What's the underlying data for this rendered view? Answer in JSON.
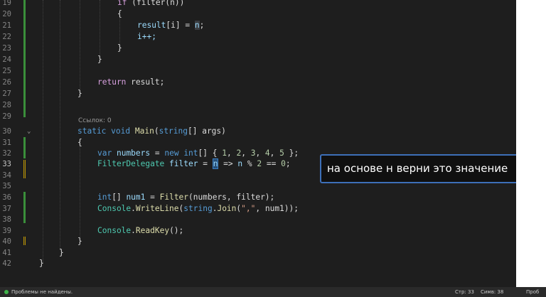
{
  "line_numbers": [
    "19",
    "20",
    "21",
    "22",
    "23",
    "24",
    "25",
    "26",
    "27",
    "28",
    "29",
    "30",
    "31",
    "32",
    "33",
    "34",
    "35",
    "36",
    "37",
    "38",
    "39",
    "40",
    "41",
    "42"
  ],
  "codelens": "Ссылок: 0",
  "code": {
    "l19_if": "if",
    "l19_rest": " (filter(n))",
    "l20": "{",
    "l21_result": "result",
    "l21_idx": "[i]",
    "l21_eq": " = ",
    "l21_n": "n",
    "l21_semi": ";",
    "l22": "i++;",
    "l23": "}",
    "l24": "}",
    "l26_return": "return",
    "l26_rest": " result;",
    "l27": "}",
    "l30_static": "static",
    "l30_void": "void",
    "l30_main": "Main",
    "l30_paren": "(",
    "l30_string": "string",
    "l30_args": "[] args)",
    "l31": "{",
    "l32_var": "var",
    "l32_numbers": "numbers",
    "l32_eq": " = ",
    "l32_new": "new",
    "l32_int": "int",
    "l32_arr": "[] { ",
    "l32_n1": "1",
    "l32_n2": "2",
    "l32_n3": "3",
    "l32_n4": "4",
    "l32_n5": "5",
    "l32_end": " };",
    "comma": ", ",
    "l33_type": "FilterDelegate",
    "l33_filter": "filter",
    "l33_eq": " = ",
    "l33_n": "n",
    "l33_arrow": " => ",
    "l33_n2": "n",
    "l33_mod": " % ",
    "l33_two": "2",
    "l33_eqeq": " == ",
    "l33_zero": "0",
    "l33_semi": ";",
    "l36_int": "int",
    "l36_arr": "[] ",
    "l36_num1": "num1",
    "l36_eq": " = ",
    "l36_filter": "Filter",
    "l36_args": "(numbers, filter);",
    "l37_console": "Console",
    "l37_dot": ".",
    "l37_write": "WriteLine",
    "l37_p": "(",
    "l37_string": "string",
    "l37_join": "Join",
    "l37_str": "\",\"",
    "l37_rest": ", num1));",
    "l39_console": "Console",
    "l39_read": "ReadKey",
    "l39_rest": "();",
    "l40": "}",
    "l41": "}",
    "l42": "}"
  },
  "tooltip": "на основе н верни это значение",
  "statusbar": {
    "problems": "Проблемы не найдены.",
    "line": "Стр: 33",
    "col": "Симв: 38",
    "right": "Проб"
  },
  "colors": {
    "background": "#1e1e1e",
    "keyword": "#569cd6",
    "type": "#4ec9b0",
    "method": "#dcdcaa",
    "tooltip_border": "#3d6fb8"
  }
}
